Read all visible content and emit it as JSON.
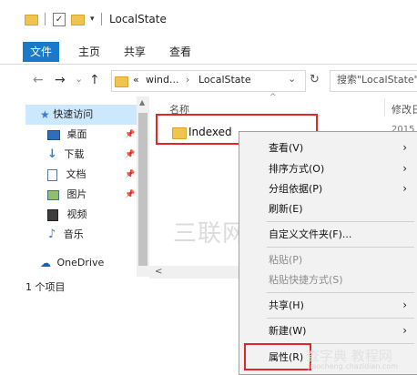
{
  "window": {
    "title": "LocalState",
    "qat_check": "✓",
    "qat_dropdown": "▾"
  },
  "ribbon": {
    "tabs": [
      "文件",
      "主页",
      "共享",
      "查看"
    ]
  },
  "nav": {
    "back": "←",
    "forward": "→",
    "dropdown": "⌄",
    "up": "↑",
    "refresh": "↻",
    "address_overflow": "«",
    "breadcrumb": [
      "wind...",
      "LocalState"
    ],
    "breadcrumb_sep": "›",
    "address_chevron": "⌄",
    "search_placeholder": "搜索\"LocalState\""
  },
  "sidebar": {
    "items": [
      {
        "label": "快速访问",
        "icon": "star-icon"
      },
      {
        "label": "桌面",
        "icon": "desktop-icon"
      },
      {
        "label": "下载",
        "icon": "download-icon"
      },
      {
        "label": "文档",
        "icon": "document-icon"
      },
      {
        "label": "图片",
        "icon": "pictures-icon"
      },
      {
        "label": "视频",
        "icon": "video-icon"
      },
      {
        "label": "音乐",
        "icon": "music-icon"
      },
      {
        "label": "OneDrive",
        "icon": "cloud-icon"
      }
    ],
    "pin": "📌"
  },
  "content": {
    "col_name": "名称",
    "col_sort": "^",
    "col_modified": "修改日",
    "date_partial": "2015",
    "rows": [
      {
        "name": "Indexed"
      }
    ]
  },
  "status": {
    "count": "1 个项目"
  },
  "context_menu": {
    "items": [
      {
        "label": "查看(V)",
        "submenu": true,
        "disabled": false
      },
      {
        "label": "排序方式(O)",
        "submenu": true,
        "disabled": false
      },
      {
        "label": "分组依据(P)",
        "submenu": true,
        "disabled": false
      },
      {
        "label": "刷新(E)",
        "submenu": false,
        "disabled": false
      },
      {
        "label": "自定义文件夹(F)...",
        "submenu": false,
        "disabled": false
      },
      {
        "label": "粘贴(P)",
        "submenu": false,
        "disabled": true
      },
      {
        "label": "粘贴快捷方式(S)",
        "submenu": false,
        "disabled": true
      },
      {
        "label": "共享(H)",
        "submenu": true,
        "disabled": false
      },
      {
        "label": "新建(W)",
        "submenu": true,
        "disabled": false
      },
      {
        "label": "属性(R)",
        "submenu": false,
        "disabled": false
      }
    ],
    "arrow": "›"
  },
  "watermarks": {
    "center": "三联网 3LIAN.COM",
    "corner_main": "查字典 教程网",
    "corner_sub": "jiaocheng.chazidian.com"
  },
  "colors": {
    "accent": "#1979ca",
    "highlight_box": "#e0262b",
    "selection": "#cce8ff",
    "folder": "#f1c34f"
  }
}
